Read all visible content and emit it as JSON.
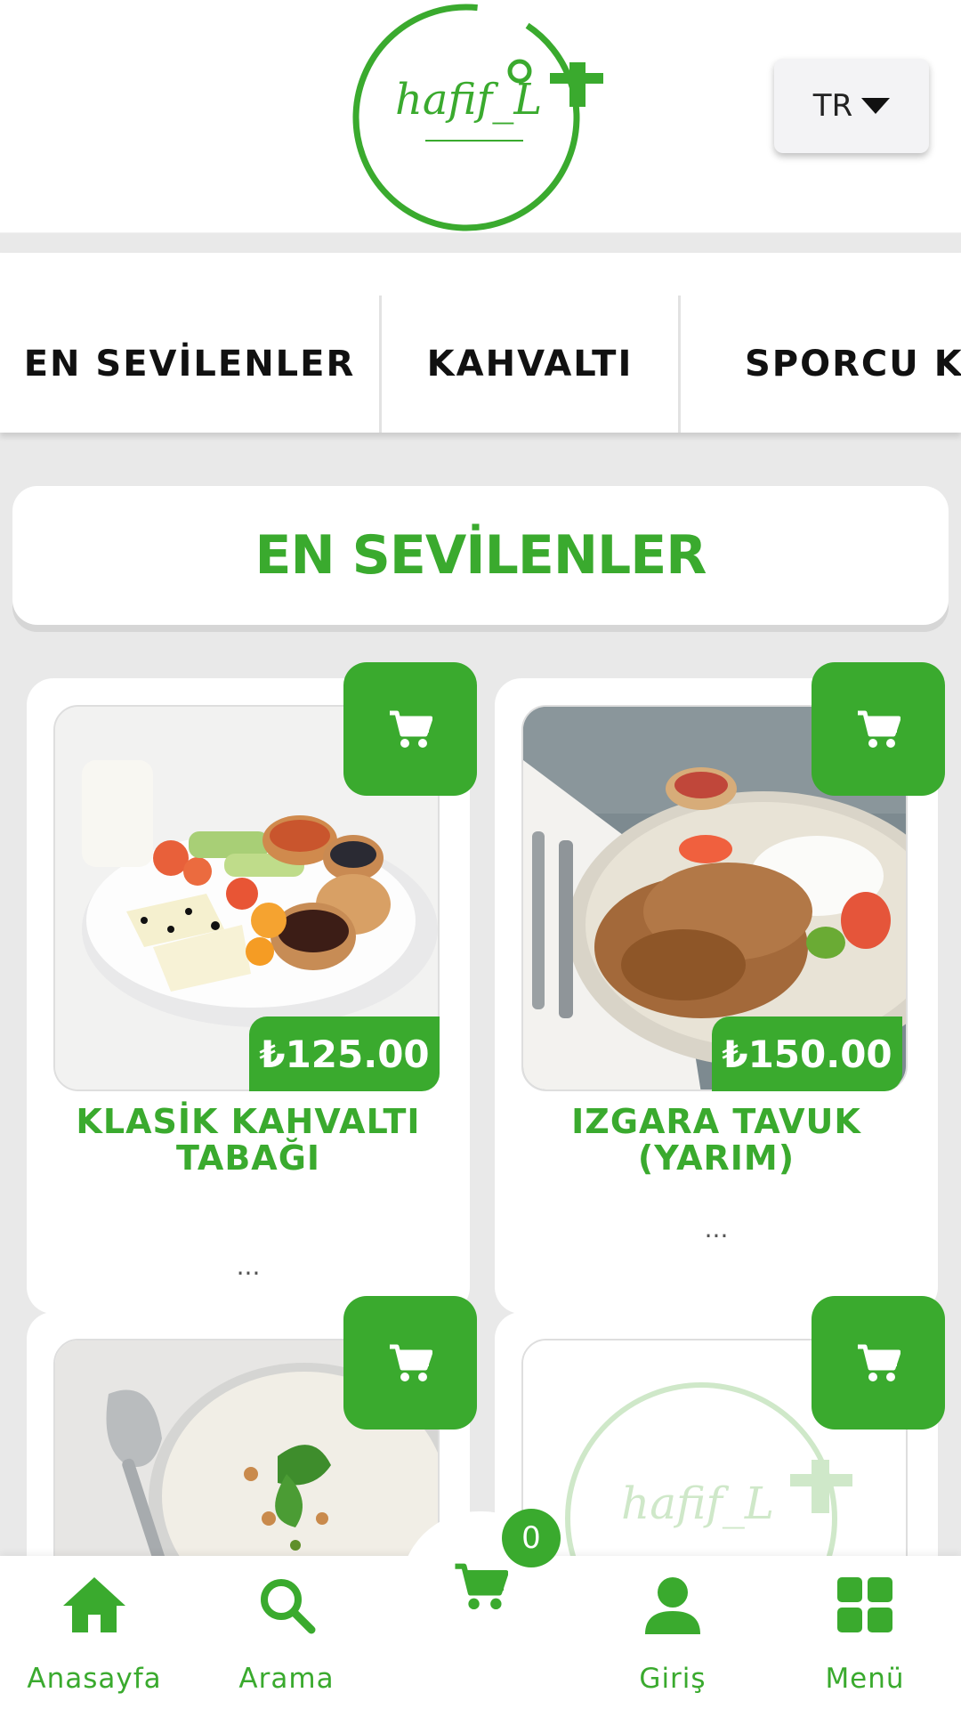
{
  "header": {
    "logo_text": "hafif_LT",
    "language": {
      "selected": "TR"
    }
  },
  "categories": [
    {
      "label": "EN SEVİLENLER"
    },
    {
      "label": "KAHVALTI"
    },
    {
      "label": "SPORCU KAHVALTISI"
    }
  ],
  "section": {
    "title": "EN SEVİLENLER"
  },
  "products": [
    {
      "name": "KLASİK KAHVALTI TABAĞI",
      "price": "₺125.00",
      "description": "..."
    },
    {
      "name": "IZGARA TAVUK (YARIM)",
      "price": "₺150.00",
      "description": "..."
    },
    {
      "name": "",
      "price": "",
      "description": ""
    },
    {
      "name": "",
      "price": "",
      "description": ""
    }
  ],
  "bottom_nav": {
    "home": "Anasayfa",
    "search": "Arama",
    "cart_count": "0",
    "login": "Giriş",
    "menu": "Menü"
  },
  "colors": {
    "accent": "#3aaa2e",
    "background": "#e9e9e9"
  },
  "icons": [
    "cart-icon",
    "home-icon",
    "search-icon",
    "user-icon",
    "grid-icon",
    "caret-down-icon"
  ]
}
